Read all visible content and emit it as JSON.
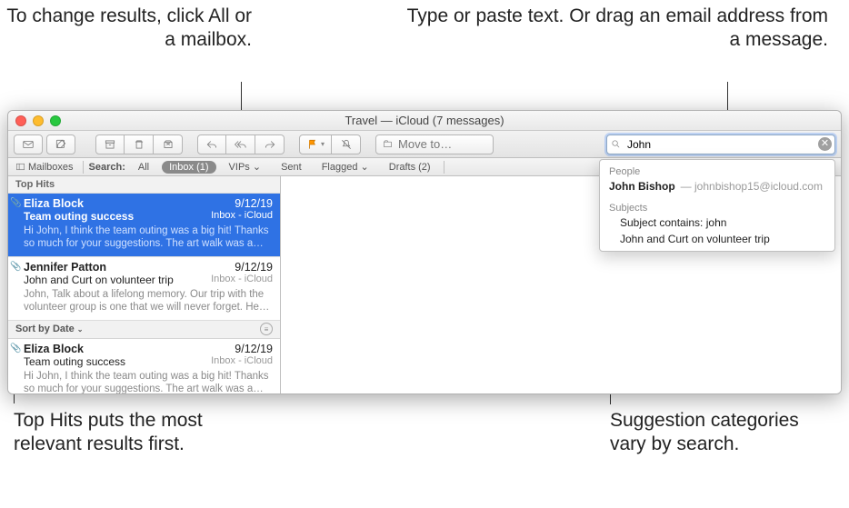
{
  "callouts": {
    "scope": "To change results, click All or a mailbox.",
    "search": "Type or paste text. Or drag an email address from a message.",
    "tophits": "Top Hits puts the most relevant results first.",
    "suggestions": "Suggestion categories vary by search."
  },
  "window_title": "Travel — iCloud (7 messages)",
  "toolbar": {
    "move_label": "Move to…"
  },
  "search": {
    "query": "John"
  },
  "scope": {
    "mailboxes": "Mailboxes",
    "search_label": "Search:",
    "tabs": {
      "all": "All",
      "inbox": "Inbox (1)",
      "vips": "VIPs",
      "sent": "Sent",
      "flagged": "Flagged",
      "drafts": "Drafts (2)"
    }
  },
  "sections": {
    "tophits": "Top Hits"
  },
  "messages": {
    "top": [
      {
        "sender": "Eliza Block",
        "date": "9/12/19",
        "subject": "Team outing success",
        "box": "Inbox - iCloud",
        "preview": "Hi John, I think the team outing was a big hit! Thanks so much for your suggestions. The art walk was a great ide…"
      },
      {
        "sender": "Jennifer Patton",
        "date": "9/12/19",
        "subject": "John and Curt on volunteer trip",
        "box": "Inbox - iCloud",
        "preview": "John, Talk about a lifelong memory. Our trip with the volunteer group is one that we will never forget. Here ar…"
      }
    ],
    "sort_label": "Sort by Date",
    "rest": [
      {
        "sender": "Eliza Block",
        "date": "9/12/19",
        "subject": "Team outing success",
        "box": "Inbox - iCloud",
        "preview": "Hi John, I think the team outing was a big hit! Thanks so much for your suggestions. The art walk was a great ide…"
      }
    ]
  },
  "suggestions": {
    "people_label": "People",
    "people": [
      {
        "name": "John Bishop",
        "detail": "johnbishop15@icloud.com"
      }
    ],
    "subjects_label": "Subjects",
    "subjects": [
      "Subject contains: john",
      "John and Curt on volunteer trip"
    ]
  }
}
